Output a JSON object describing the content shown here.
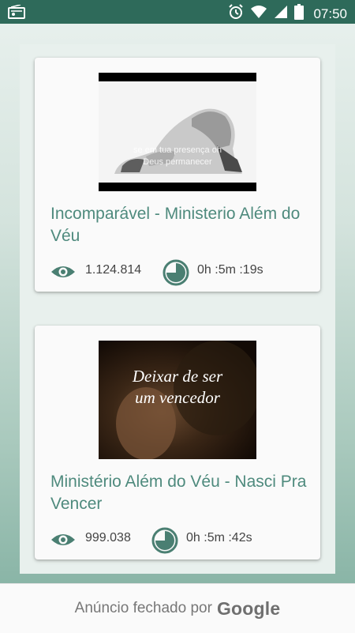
{
  "status_bar": {
    "time": "07:50",
    "icons": [
      "radio-icon",
      "alarm-icon",
      "wifi-icon",
      "signal-icon",
      "battery-icon"
    ]
  },
  "videos": [
    {
      "title": "Incomparável - Ministerio Além do Véu",
      "views": "1.124.814",
      "duration": "0h :5m :19s",
      "thumbnail_text": [
        "se em tua presença oh",
        "Deus permanecer"
      ]
    },
    {
      "title": "Ministério Além do Véu - Nasci Pra Vencer",
      "views": "999.038",
      "duration": "0h :5m :42s",
      "thumbnail_text": [
        "Deixar de ser",
        "um vencedor"
      ]
    }
  ],
  "ad_bar": {
    "text": "Anúncio fechado por",
    "brand": "Google"
  },
  "colors": {
    "status_bar": "#2e6a5a",
    "accent": "#4e8a7d",
    "icon": "#4a7f72"
  }
}
